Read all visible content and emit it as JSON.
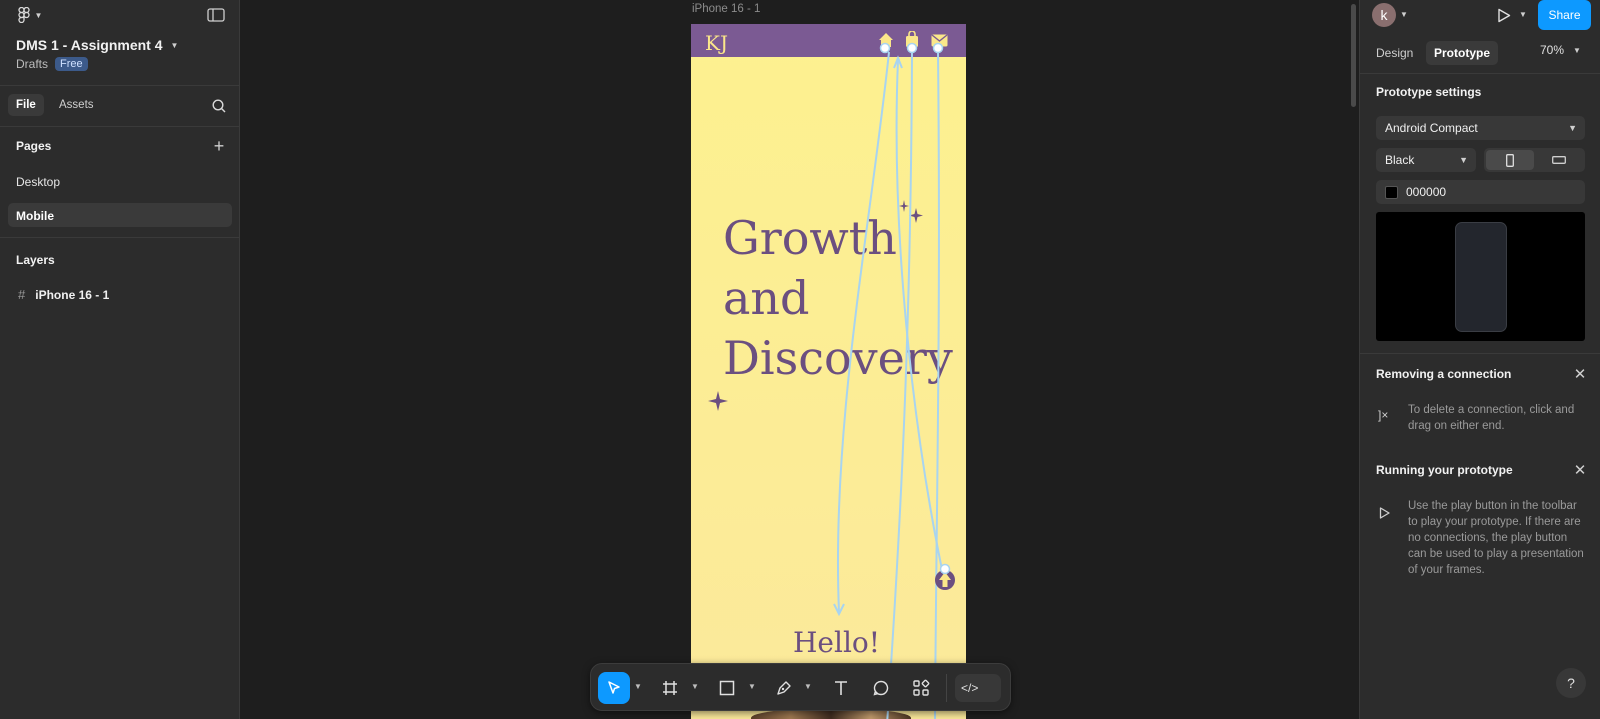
{
  "left_panel": {
    "project_title": "DMS 1 - Assignment 4",
    "drafts_label": "Drafts",
    "plan_badge": "Free",
    "tabs": [
      "File",
      "Assets"
    ],
    "pages_heading": "Pages",
    "pages": [
      "Desktop",
      "Mobile"
    ],
    "layers_heading": "Layers",
    "layers": [
      "iPhone 16 - 1"
    ]
  },
  "canvas": {
    "frame_label": "iPhone 16 - 1",
    "logo": "KJ",
    "headline_lines": [
      "Growth",
      "and",
      "Discovery"
    ],
    "hello": "Hello!"
  },
  "right_panel": {
    "avatar_letter": "k",
    "share_label": "Share",
    "tabs": [
      "Design",
      "Prototype"
    ],
    "zoom": "70%",
    "prototype_settings": "Prototype settings",
    "device": "Android Compact",
    "device_color": "Black",
    "bg_hex": "000000",
    "tip1_title": "Removing a connection",
    "tip1_body": "To delete a connection, click and drag on either end.",
    "tip2_title": "Running your prototype",
    "tip2_body": "Use the play button in the toolbar to play your prototype. If there are no connections, the play button can be used to play a presentation of your frames."
  },
  "help_label": "?",
  "colors": {
    "accent": "#0d99ff",
    "frame_purple": "#7b5a93",
    "frame_yellow": "#fdf18f",
    "connection": "#a8d4f0"
  }
}
